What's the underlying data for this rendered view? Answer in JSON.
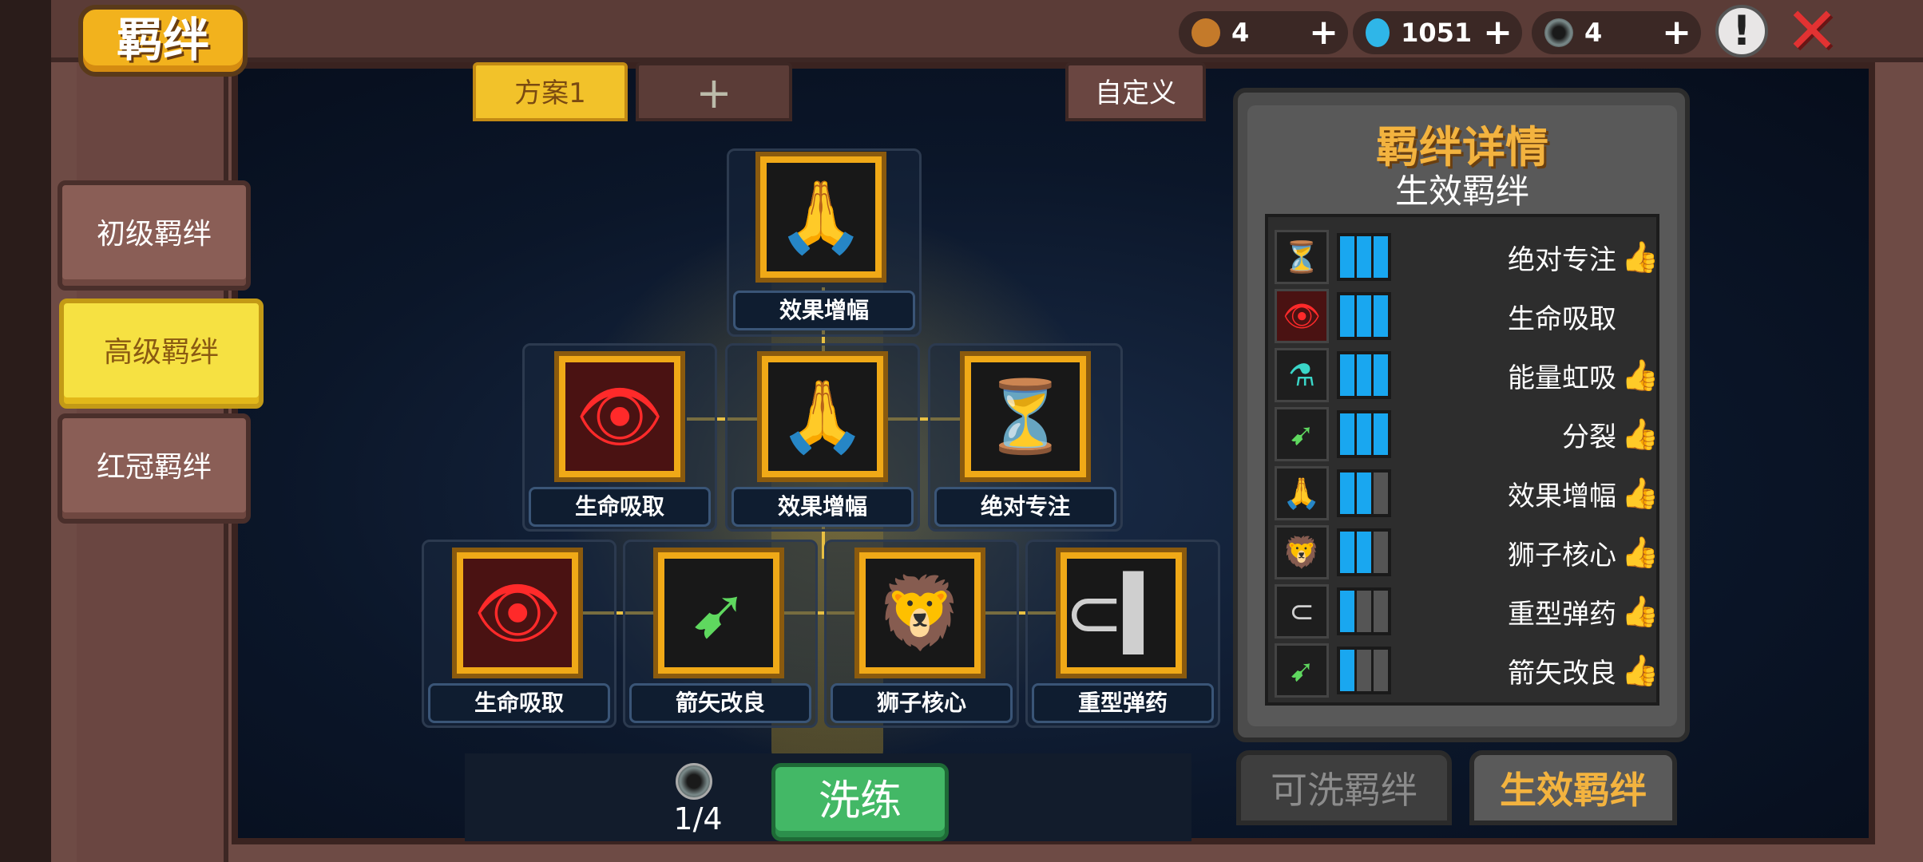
{
  "header": {
    "title": "羁绊",
    "resources": [
      {
        "icon": "horn-icon",
        "value": "4"
      },
      {
        "icon": "gem-icon",
        "value": "1051"
      },
      {
        "icon": "ring-icon",
        "value": "4"
      }
    ],
    "plus": "+",
    "info_glyph": "!",
    "close_glyph": "✕"
  },
  "sidebar": {
    "items": [
      {
        "label": "初级羁绊",
        "active": false
      },
      {
        "label": "高级羁绊",
        "active": true
      },
      {
        "label": "红冠羁绊",
        "active": false
      }
    ]
  },
  "plans": {
    "active_label": "方案1",
    "add_label": "+",
    "custom_label": "自定义"
  },
  "tree": {
    "top": {
      "label": "效果增幅",
      "icon": "hands-icon"
    },
    "middle": [
      {
        "label": "生命吸取",
        "icon": "red-eyes-icon"
      },
      {
        "label": "效果增幅",
        "icon": "hands-icon"
      },
      {
        "label": "绝对专注",
        "icon": "hourglass-icon"
      }
    ],
    "bottom": [
      {
        "label": "生命吸取",
        "icon": "red-eyes-icon"
      },
      {
        "label": "箭矢改良",
        "icon": "arrows-icon"
      },
      {
        "label": "狮子核心",
        "icon": "lion-icon"
      },
      {
        "label": "重型弹药",
        "icon": "bullet-icon"
      }
    ]
  },
  "detail": {
    "title": "羁绊详情",
    "subtitle": "生效羁绊",
    "rows": [
      {
        "name": "绝对专注",
        "icon": "hourglass-icon",
        "level": 3,
        "thumb": true
      },
      {
        "name": "生命吸取",
        "icon": "red-eyes-icon",
        "level": 3,
        "thumb": false
      },
      {
        "name": "能量虹吸",
        "icon": "siphon-icon",
        "level": 3,
        "thumb": true
      },
      {
        "name": "分裂",
        "icon": "split-icon",
        "level": 3,
        "thumb": true
      },
      {
        "name": "效果增幅",
        "icon": "hands-icon",
        "level": 2,
        "thumb": true
      },
      {
        "name": "狮子核心",
        "icon": "lion-icon",
        "level": 2,
        "thumb": true
      },
      {
        "name": "重型弹药",
        "icon": "bullet-icon",
        "level": 1,
        "thumb": true
      },
      {
        "name": "箭矢改良",
        "icon": "arrows-icon",
        "level": 1,
        "thumb": true
      }
    ],
    "max_level": 3,
    "tab_inactive": "可洗羁绊",
    "tab_active": "生效羁绊"
  },
  "bottom": {
    "count": "1/4",
    "refine_label": "洗练"
  },
  "colors": {
    "accent_gold": "#f2b21d",
    "bar_blue": "#19a7f0",
    "refine_green": "#43b866",
    "close_red": "#e23232"
  }
}
